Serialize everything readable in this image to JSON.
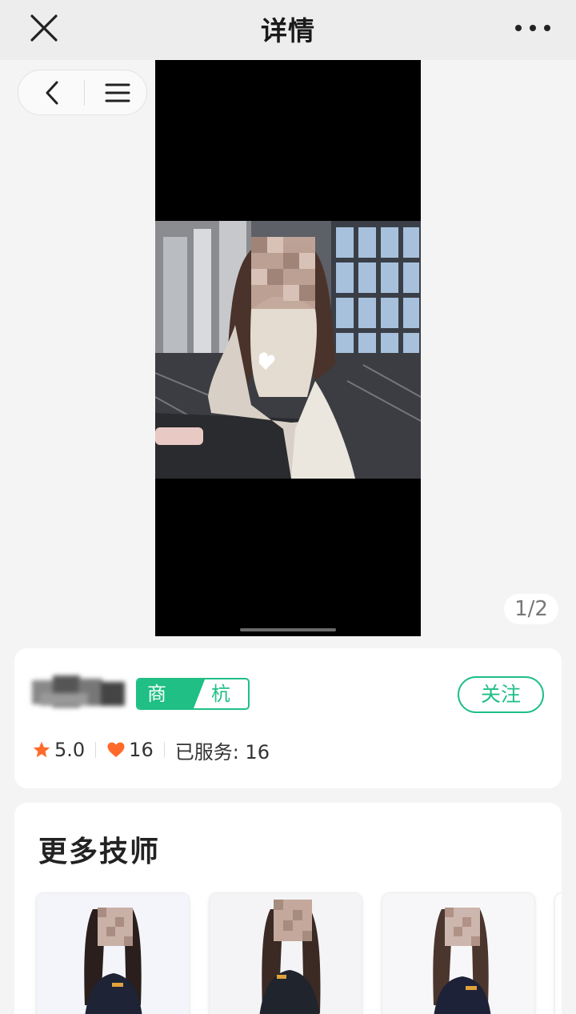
{
  "header": {
    "title": "详情",
    "close_icon": "close-icon",
    "more_icon": "more-dots-icon"
  },
  "capsule": {
    "back_icon": "chevron-left-icon",
    "menu_icon": "hamburger-menu-icon"
  },
  "media": {
    "pager": "1/2",
    "image": "photo-of-woman-seated-at-table"
  },
  "profile": {
    "tag_role": "商家",
    "tag_city": "杭州",
    "follow_label": "关注",
    "rating": "5.0",
    "likes": "16",
    "served": "已服务: 16",
    "colors": {
      "accent": "#1fbf86",
      "star": "#ff6a2a",
      "heart": "#ff6a2a"
    }
  },
  "more_section": {
    "title": "更多技师",
    "technicians": [
      {
        "image": "technician-photo-1"
      },
      {
        "image": "technician-photo-2"
      },
      {
        "image": "technician-photo-3"
      }
    ]
  }
}
